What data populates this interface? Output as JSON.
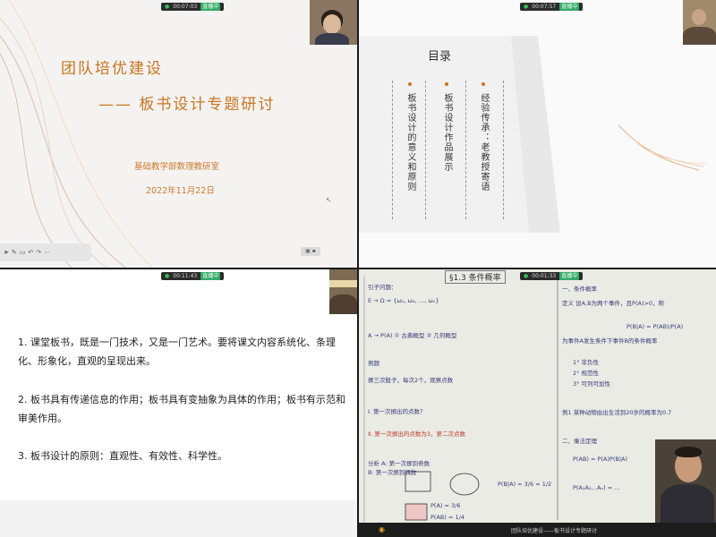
{
  "recorder": {
    "tl_time": "00:07:03",
    "tr_time": "00:07:57",
    "bl_time": "00:11:43",
    "br_time": "00:01:33",
    "tag": "直播中"
  },
  "slide1": {
    "title": "团队培优建设",
    "subtitle": "—— 板书设计专题研讨",
    "org": "基础教学部数理教研室",
    "date": "2022年11月22日"
  },
  "slide2": {
    "heading": "目录",
    "items": [
      "板书设计的意义和原则",
      "板书设计作品展示",
      "经验传承：老教授寄语"
    ]
  },
  "slide3": {
    "points": [
      "1. 课堂板书，既是一门技术，又是一门艺术。要将课文内容系统化、条理化、形象化，直观的呈现出来。",
      "2. 板书具有传递信息的作用；板书具有变抽象为具体的作用；板书有示范和审美作用。",
      "3. 板书设计的原则：直观性、有效性、科学性。"
    ]
  },
  "board": {
    "title": "§1.3 条件概率",
    "lines_left": [
      "引子问题：",
      "E → Ω = {ω₁, ω₂, …, ωₙ}",
      "A → P(A)  ① 古典概型  ② 几何概型",
      "例题",
      "掷三次骰子，每次2个，观察点数",
      "Ⅰ. 第一次掷出的点数？",
      "Ⅱ. 第一次掷出的点数为3，第二次点数",
      "分析  A: 第一次掷到奇数",
      "B: 第一次掷到偶数",
      "P(B|A) = 3/6 = 1/2",
      "P(A) = 3/6",
      "P(AB) = 1/4"
    ],
    "lines_right": [
      "一、条件概率",
      "定义 设A,B为两个事件，且P(A)>0，称",
      "P(B|A) = P(AB)/P(A)",
      "为事件A发生条件下事件B的条件概率",
      "1° 非负性",
      "2° 规范性",
      "3° 可列可加性",
      "例1  某种动物由出生活到20岁的概率为0.7",
      "二、乘法定理",
      "P(AB) = P(A)P(B|A)",
      "P(A₁A₂…Aₙ) = …"
    ],
    "footer": "团队培优建设——板书设计专题研讨"
  },
  "icons": {
    "toolbar": [
      "arrow-icon",
      "pen-icon",
      "eraser-icon",
      "undo-icon",
      "redo-icon",
      "more-icon"
    ]
  }
}
